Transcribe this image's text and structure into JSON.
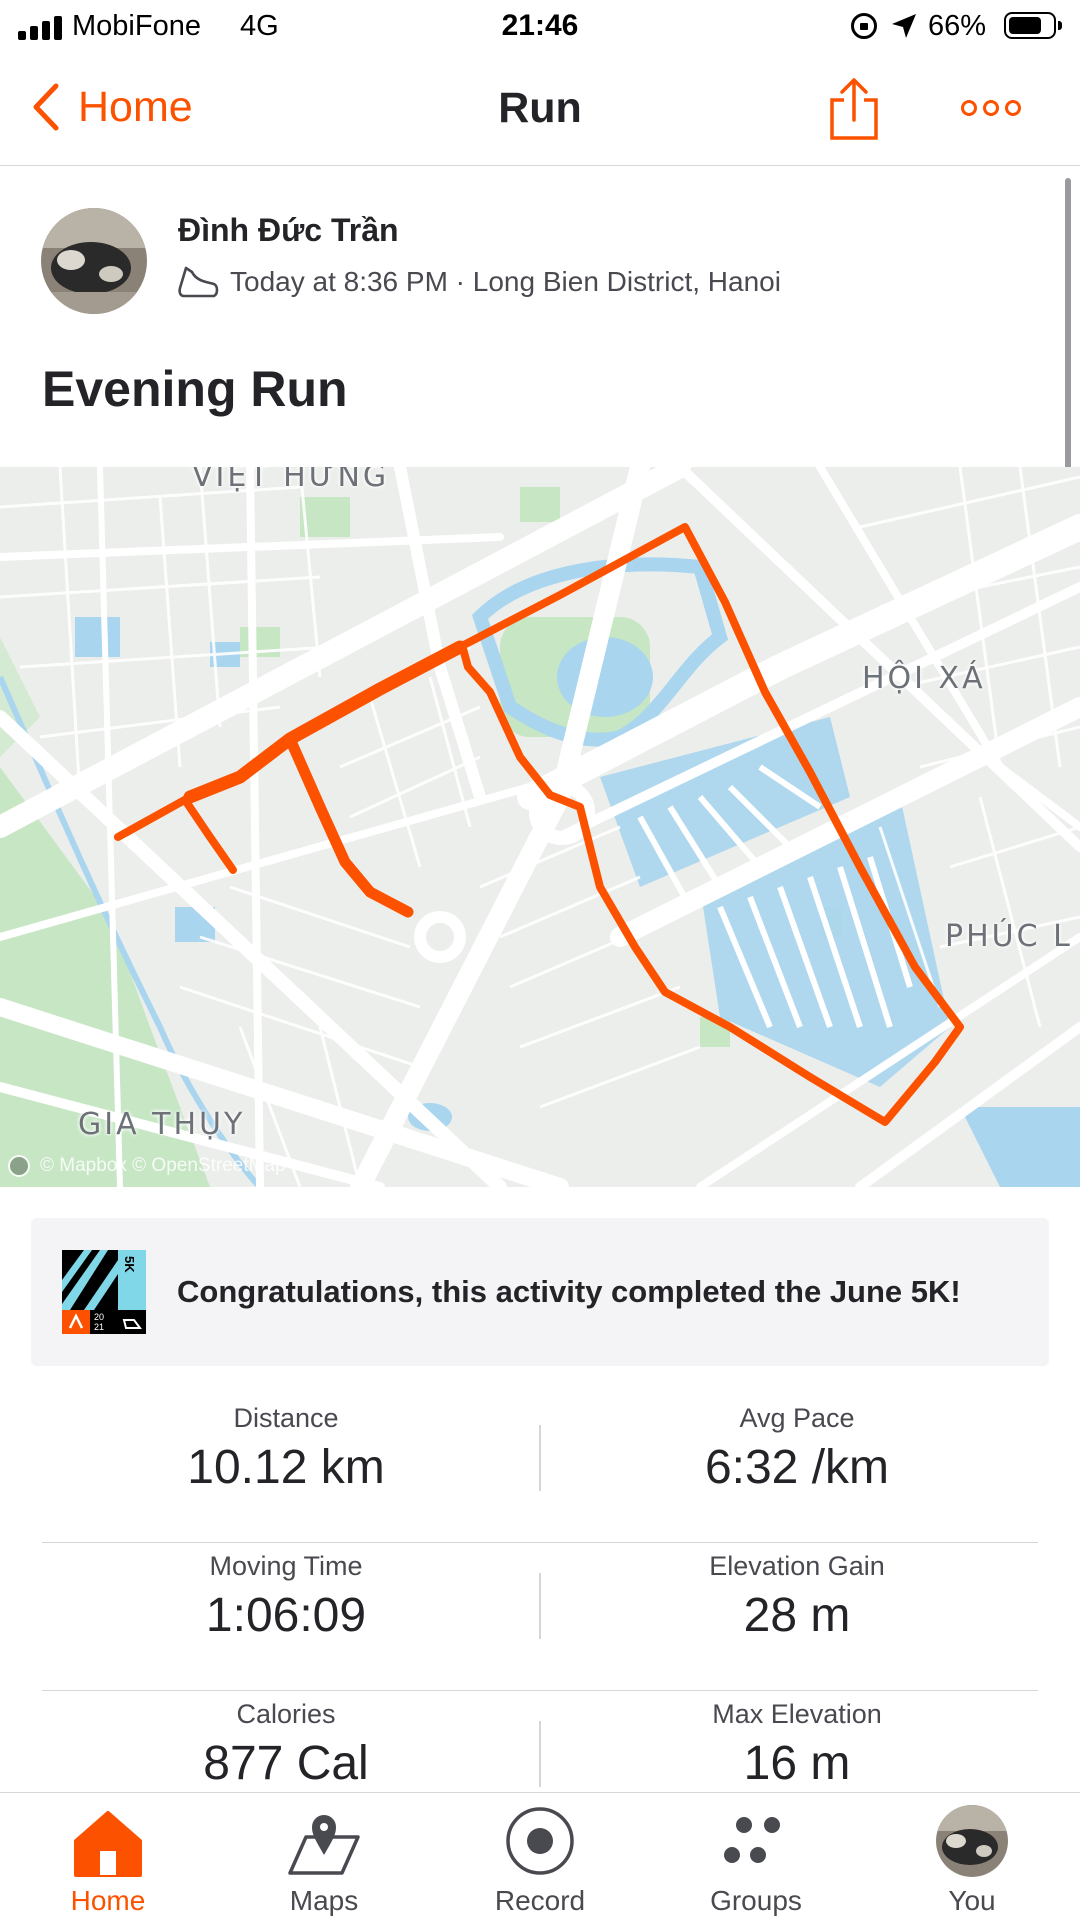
{
  "status_bar": {
    "carrier": "MobiFone",
    "network": "4G",
    "time": "21:46",
    "battery_percent": "66%",
    "battery_level": 0.66,
    "icons": [
      "signal-icon",
      "rotation-lock-icon",
      "location-arrow-icon",
      "battery-icon"
    ]
  },
  "nav": {
    "back_label": "Home",
    "title": "Run",
    "icons": [
      "chevron-left-icon",
      "share-icon",
      "more-icon"
    ]
  },
  "activity": {
    "athlete_name": "Đình Đức Trần",
    "meta": "Today at 8:36 PM · Long Bien District, Hanoi",
    "title": "Evening Run",
    "type_icon": "shoe-icon"
  },
  "map": {
    "labels": {
      "viet_hung": "VIỆT HƯNG",
      "hoi_xa": "HỘI XÁ",
      "phuc_loi": "PHÚC L",
      "gia_thuy": "GIA THỤY"
    },
    "attribution": "© Mapbox © OpenStreetMap",
    "route_color": "#fc5200"
  },
  "challenge": {
    "text": "Congratulations, this activity completed the June 5K!",
    "badge_text": "5K",
    "badge_year": "20 21"
  },
  "stats": {
    "distance": {
      "label": "Distance",
      "value": "10.12 km"
    },
    "avg_pace": {
      "label": "Avg Pace",
      "value": "6:32 /km"
    },
    "moving_time": {
      "label": "Moving Time",
      "value": "1:06:09"
    },
    "elevation_gain": {
      "label": "Elevation Gain",
      "value": "28 m"
    },
    "calories": {
      "label": "Calories",
      "value": "877 Cal"
    },
    "max_elevation": {
      "label": "Max Elevation",
      "value": "16 m"
    }
  },
  "tab_bar": {
    "home": "Home",
    "maps": "Maps",
    "record": "Record",
    "groups": "Groups",
    "you": "You",
    "active": "home"
  },
  "colors": {
    "accent": "#fc5200",
    "text": "#242428",
    "water": "#a9d5ef",
    "park": "#c6e6c4"
  }
}
